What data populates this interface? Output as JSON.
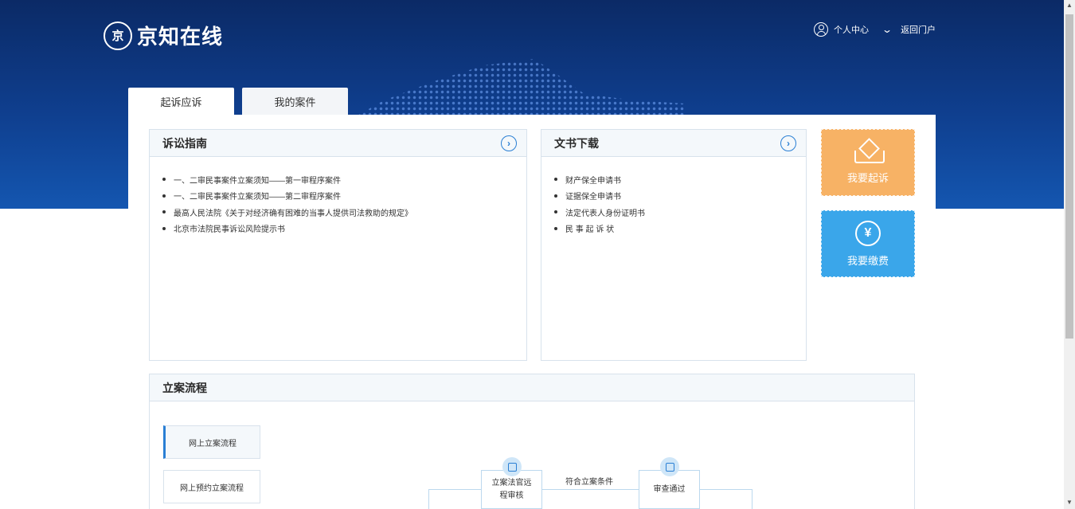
{
  "header": {
    "logo_mark": "京",
    "logo_text": "京知在线",
    "personal_center": "个人中心",
    "return_portal": "返回门户",
    "chevron": "⌄"
  },
  "tabs": [
    {
      "label": "起诉应诉",
      "active": true
    },
    {
      "label": "我的案件",
      "active": false
    }
  ],
  "guide": {
    "title": "诉讼指南",
    "more": "›",
    "items": [
      "一、二审民事案件立案须知——第一审程序案件",
      "一、二审民事案件立案须知——第二审程序案件",
      "最高人民法院《关于对经济确有困难的当事人提供司法救助的规定》",
      "北京市法院民事诉讼风险提示书"
    ]
  },
  "downloads": {
    "title": "文书下载",
    "more": "›",
    "items": [
      "财产保全申请书",
      "证据保全申请书",
      "法定代表人身份证明书",
      "民 事 起 诉 状"
    ]
  },
  "actions": {
    "sue": {
      "label": "我要起诉",
      "color": "#f7b265"
    },
    "pay": {
      "label": "我要缴费",
      "color": "#3aa6ea",
      "icon_glyph": "¥"
    }
  },
  "flow": {
    "title": "立案流程",
    "buttons": [
      "网上立案流程",
      "网上预约立案流程"
    ],
    "nodes": {
      "review": "立案法官远程审核",
      "condition": "符合立案条件",
      "passed": "审查通过"
    }
  },
  "scrollbar": {
    "up": "▲",
    "down": "▼"
  }
}
